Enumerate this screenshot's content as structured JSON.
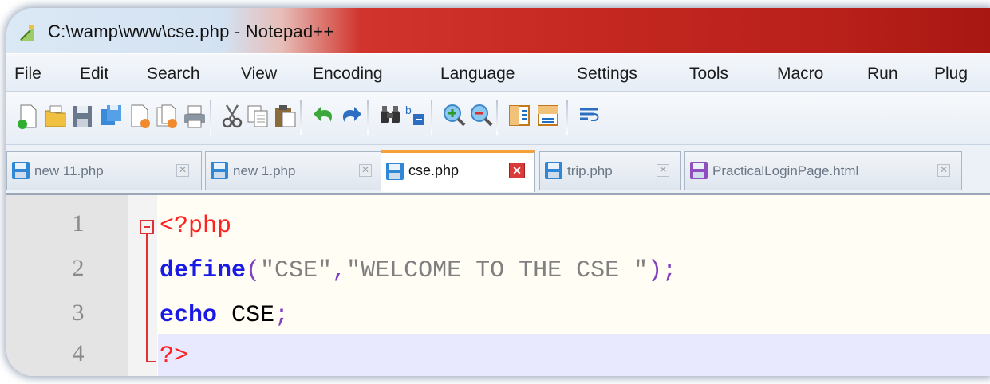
{
  "window": {
    "title": "C:\\wamp\\www\\cse.php - Notepad++",
    "icon": "notepad-plus-plus-icon"
  },
  "menu": [
    "File",
    "Edit",
    "Search",
    "View",
    "Encoding",
    "Language",
    "Settings",
    "Tools",
    "Macro",
    "Run",
    "Plug"
  ],
  "toolbar": {
    "buttons": [
      "new-file",
      "open-file",
      "save",
      "save-all",
      "close",
      "close-all",
      "print",
      "cut",
      "copy",
      "paste",
      "undo",
      "redo",
      "find",
      "replace",
      "zoom-in",
      "zoom-out",
      "sync-vertical",
      "sync-horizontal",
      "word-wrap"
    ]
  },
  "tabs": [
    {
      "label": "new 11.php",
      "active": false,
      "color": "#2f87d6"
    },
    {
      "label": "new 1.php",
      "active": false,
      "color": "#2f87d6"
    },
    {
      "label": "cse.php",
      "active": true,
      "color": "#2f87d6"
    },
    {
      "label": "trip.php",
      "active": false,
      "color": "#2f87d6"
    },
    {
      "label": "PracticalLoginPage.html",
      "active": false,
      "color": "#8f4fbf"
    }
  ],
  "tab_close_glyph": "✕",
  "editor": {
    "line_numbers": [
      "1",
      "2",
      "3",
      "4"
    ],
    "lines": [
      {
        "tokens": [
          {
            "type": "tag",
            "text": "<?php"
          }
        ]
      },
      {
        "tokens": [
          {
            "type": "kw",
            "text": "define"
          },
          {
            "type": "punc",
            "text": "("
          },
          {
            "type": "str",
            "text": "\"CSE\""
          },
          {
            "type": "punc",
            "text": ","
          },
          {
            "type": "str",
            "text": "\"WELCOME TO THE CSE \""
          },
          {
            "type": "punc",
            "text": ");"
          }
        ]
      },
      {
        "tokens": [
          {
            "type": "kw",
            "text": "echo"
          },
          {
            "type": "plain",
            "text": " CSE"
          },
          {
            "type": "punc",
            "text": ";"
          }
        ]
      },
      {
        "tokens": [
          {
            "type": "tag",
            "text": "?>"
          }
        ]
      }
    ],
    "current_line": 4
  },
  "colors": {
    "accent_tab": "#f7a035",
    "keyword": "#1a1ae6",
    "php_tag": "#ff2020"
  }
}
